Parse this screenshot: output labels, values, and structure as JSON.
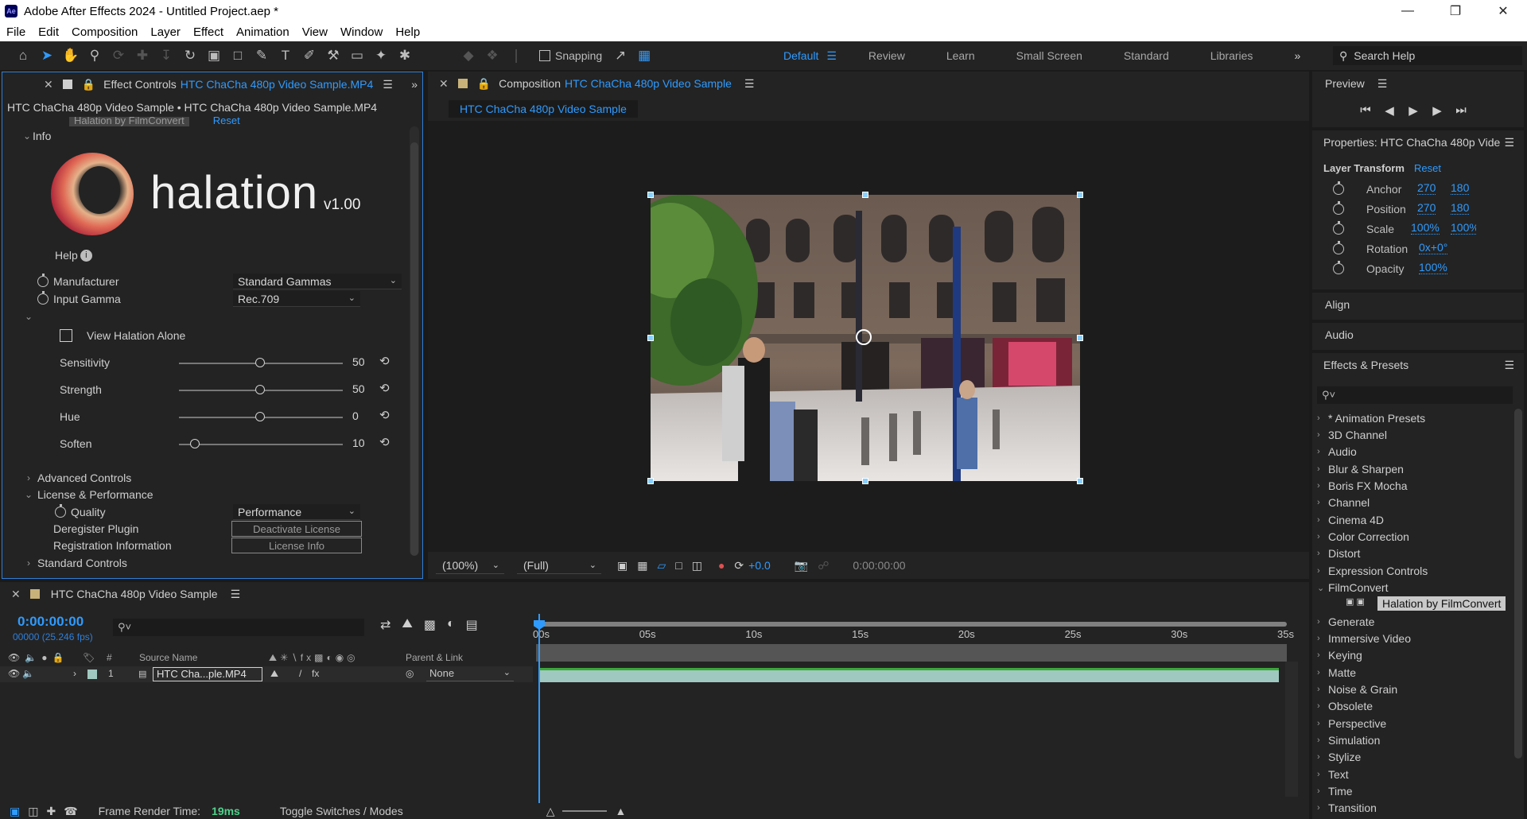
{
  "window": {
    "title": "Adobe After Effects 2024 - Untitled Project.aep *",
    "app_icon": "Ae"
  },
  "menu": [
    "File",
    "Edit",
    "Composition",
    "Layer",
    "Effect",
    "Animation",
    "View",
    "Window",
    "Help"
  ],
  "toolbar": {
    "snapping_label": "Snapping",
    "workspaces": [
      "Default",
      "Review",
      "Learn",
      "Small Screen",
      "Standard",
      "Libraries"
    ],
    "search_help": "Search Help"
  },
  "effect_controls": {
    "tab_prefix": "Effect Controls",
    "tab_file": "HTC ChaCha 480p Video Sample.MP4",
    "subtitle": "HTC ChaCha 480p Video Sample • HTC ChaCha 480p Video Sample.MP4",
    "effect_name": "Halation by FilmConvert",
    "effect_reset": "Reset",
    "info_label": "Info",
    "logo_text": "halation",
    "version": "v1.00",
    "help_label": "Help",
    "manufacturer_label": "Manufacturer",
    "manufacturer_value": "Standard Gammas",
    "input_gamma_label": "Input Gamma",
    "input_gamma_value": "Rec.709",
    "view_alone_label": "View Halation Alone",
    "sliders": [
      {
        "label": "Sensitivity",
        "value": "50",
        "fraction": 0.5
      },
      {
        "label": "Strength",
        "value": "50",
        "fraction": 0.5
      },
      {
        "label": "Hue",
        "value": "0",
        "fraction": 0.5
      },
      {
        "label": "Soften",
        "value": "10",
        "fraction": 0.1
      }
    ],
    "advanced_controls": "Advanced Controls",
    "license_performance": "License & Performance",
    "quality_label": "Quality",
    "quality_value": "Performance",
    "deregister_label": "Deregister Plugin",
    "deactivate_button": "Deactivate License",
    "registration_label": "Registration Information",
    "license_info_button": "License Info",
    "standard_controls": "Standard Controls"
  },
  "composition": {
    "tab_prefix": "Composition",
    "tab_name": "HTC ChaCha 480p Video Sample",
    "viewer_tab": "HTC ChaCha 480p Video Sample",
    "zoom": "(100%)",
    "resolution": "(Full)",
    "exposure": "+0.0",
    "timecode": "0:00:00:00"
  },
  "preview": {
    "title": "Preview"
  },
  "properties": {
    "title": "Properties: HTC ChaCha 480p Vide",
    "section": "Layer Transform",
    "reset": "Reset",
    "rows": [
      {
        "label": "Anchor",
        "v1": "270",
        "v2": "180"
      },
      {
        "label": "Position",
        "v1": "270",
        "v2": "180"
      },
      {
        "label": "Scale",
        "v1": "100%",
        "v2": "100%"
      },
      {
        "label": "Rotation",
        "v1": "0x+0°",
        "v2": ""
      },
      {
        "label": "Opacity",
        "v1": "100%",
        "v2": ""
      }
    ]
  },
  "align": {
    "title": "Align"
  },
  "audio": {
    "title": "Audio"
  },
  "effects_presets": {
    "title": "Effects & Presets",
    "items": [
      "* Animation Presets",
      "3D Channel",
      "Audio",
      "Blur & Sharpen",
      "Boris FX Mocha",
      "Channel",
      "Cinema 4D",
      "Color Correction",
      "Distort",
      "Expression Controls",
      "FilmConvert",
      "Generate",
      "Immersive Video",
      "Keying",
      "Matte",
      "Noise & Grain",
      "Obsolete",
      "Perspective",
      "Simulation",
      "Stylize",
      "Text",
      "Time",
      "Transition"
    ],
    "selected_effect": "Halation by FilmConvert"
  },
  "timeline": {
    "tab_name": "HTC ChaCha 480p Video Sample",
    "timecode": "0:00:00:00",
    "fps": "00000 (25.246 fps)",
    "col_number": "#",
    "col_source": "Source Name",
    "col_parent": "Parent & Link",
    "layer_number": "1",
    "layer_name": "HTC Cha...ple.MP4",
    "layer_parent": "None",
    "ticks": [
      "00s",
      "05s",
      "10s",
      "15s",
      "20s",
      "25s",
      "30s",
      "35s"
    ],
    "render_time_label": "Frame Render Time:",
    "render_time_value": "19ms",
    "toggle_label": "Toggle Switches / Modes"
  },
  "colors": {
    "accent": "#2f9bff",
    "panel": "#232323",
    "bg": "#1a1a1a",
    "layer_bar": "#9fc9c0"
  }
}
